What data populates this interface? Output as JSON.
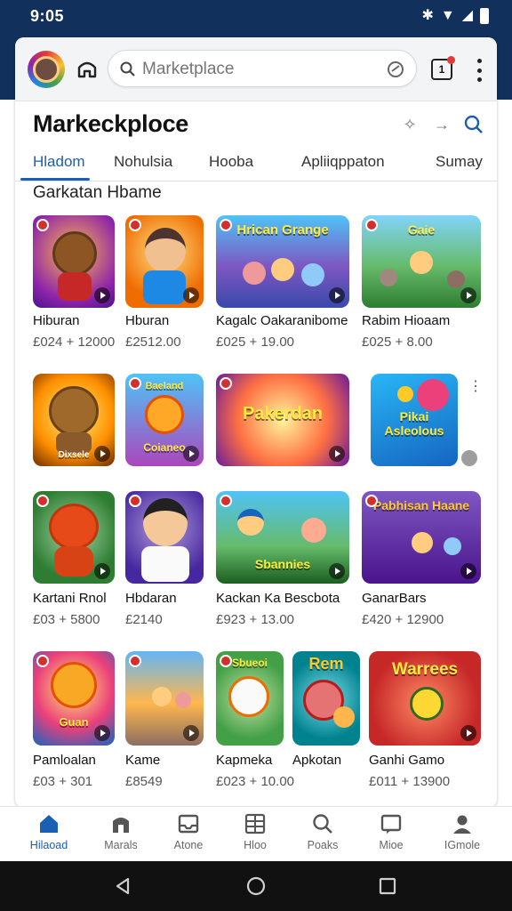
{
  "status_bar": {
    "time": "9:05",
    "icons": [
      "bluetooth-icon",
      "wifi-icon",
      "signal-icon",
      "battery-icon"
    ]
  },
  "browser": {
    "search_placeholder": "Marketplace",
    "tabs_count": "1"
  },
  "page": {
    "title": "Markeckploce",
    "tabs": [
      {
        "label": "Hladom",
        "active": true
      },
      {
        "label": "Nohulsia",
        "active": false
      },
      {
        "label": "Hooba",
        "active": false
      },
      {
        "label": "Apliiqppaton",
        "active": false
      },
      {
        "label": "Sumay",
        "active": false
      }
    ],
    "section_title": "Garkatan Hbame"
  },
  "rows": [
    [
      {
        "name": "Hiburan",
        "price": "£024 + 12000"
      },
      {
        "name": "Hburan",
        "price": "£2512.00"
      },
      {
        "name": "Kagalc Oakaranibome",
        "price": "£025 + 19.00"
      },
      {
        "name": "Rabim Hioaam",
        "price": "£025 + 8.00"
      }
    ],
    [
      {
        "name": "",
        "price": "",
        "art": "Dixsele"
      },
      {
        "name": "",
        "price": "",
        "art": "Coianeo"
      },
      {
        "name": "",
        "price": "",
        "art": "Pakerdan"
      },
      {
        "name": "",
        "price": "",
        "art": "Pikai Asleolous"
      }
    ],
    [
      {
        "name": "Kartani Rnol",
        "price": "£03 + 5800"
      },
      {
        "name": "Hbdaran",
        "price": "£2140"
      },
      {
        "name": "Kackan Ka Bescbota",
        "price": "£923 + 13.00"
      },
      {
        "name": "GanarBars",
        "price": "£420 + 12900"
      }
    ],
    [
      {
        "name": "Pamloalan",
        "price": "£03 + 301"
      },
      {
        "name": "Kame",
        "price": "£8549"
      },
      {
        "name": "Kapmeka",
        "price": "£023 + 10.00"
      },
      {
        "name": "Apkotan",
        "price": ""
      },
      {
        "name": "Ganhi Gamo",
        "price": "£011 + 13900"
      }
    ]
  ],
  "thumb_art": {
    "r1c3": "Hrican Grange",
    "r1c4": "Gaie",
    "r3c3": "Sbannies",
    "r3c4": "Pabhisan Haane",
    "r4c1": "Guan",
    "r4c3": "Sbueoi",
    "r4c4": "Rem",
    "r4c5": "Warrees"
  },
  "bottom_nav": [
    {
      "label": "Hilaoad",
      "icon": "home-icon",
      "active": true
    },
    {
      "label": "Marals",
      "icon": "store-icon",
      "active": false
    },
    {
      "label": "Atone",
      "icon": "inbox-icon",
      "active": false
    },
    {
      "label": "Hloo",
      "icon": "grid-icon",
      "active": false
    },
    {
      "label": "Poaks",
      "icon": "search-icon",
      "active": false
    },
    {
      "label": "Mioe",
      "icon": "message-icon",
      "active": false
    },
    {
      "label": "IGmole",
      "icon": "profile-icon",
      "active": false
    }
  ],
  "colors": {
    "status_bar": "#11305c",
    "accent": "#1a5fb4",
    "badge": "#d32f2f"
  }
}
